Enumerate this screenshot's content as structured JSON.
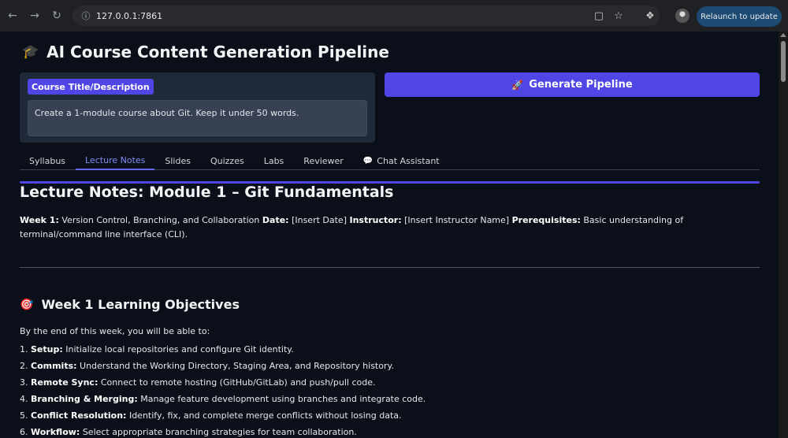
{
  "browser": {
    "url": "127.0.0.1:7861",
    "relaunch_label": "Relaunch to update",
    "icons": {
      "back": "arrow-left-icon",
      "forward": "arrow-right-icon",
      "reload": "reload-icon",
      "site_info": "info-icon",
      "install": "install-app-icon",
      "bookmark": "star-icon",
      "extensions": "puzzle-icon",
      "profile": "avatar"
    }
  },
  "app": {
    "title_emoji": "🎓",
    "title": "AI Course Content Generation Pipeline",
    "input_label": "Course Title/Description",
    "input_value": "Create a 1-module course about Git. Keep it under 50 words.",
    "generate_emoji": "🚀",
    "generate_label": "Generate Pipeline",
    "accent_color": "#4f46e5"
  },
  "tabs": [
    {
      "label": "Syllabus"
    },
    {
      "label": "Lecture Notes",
      "active": true
    },
    {
      "label": "Slides"
    },
    {
      "label": "Quizzes"
    },
    {
      "label": "Labs"
    },
    {
      "label": "Reviewer"
    },
    {
      "label": "Chat Assistant",
      "icon": "💬"
    }
  ],
  "content": {
    "heading": "Lecture Notes: Module 1 – Git Fundamentals",
    "meta": {
      "week_label": "Week 1:",
      "week_value": "Version Control, Branching, and Collaboration",
      "date_label": "Date:",
      "date_value": "[Insert Date]",
      "instructor_label": "Instructor:",
      "instructor_value": "[Insert Instructor Name]",
      "prereq_label": "Prerequisites:",
      "prereq_value": "Basic understanding of terminal/command line interface (CLI)."
    },
    "objectives_emoji": "🎯",
    "objectives_heading": "Week 1 Learning Objectives",
    "objectives_intro": "By the end of this week, you will be able to:",
    "objectives": [
      {
        "num": "1.",
        "label": "Setup:",
        "text": "Initialize local repositories and configure Git identity."
      },
      {
        "num": "2.",
        "label": "Commits:",
        "text": "Understand the Working Directory, Staging Area, and Repository history."
      },
      {
        "num": "3.",
        "label": "Remote Sync:",
        "text": "Connect to remote hosting (GitHub/GitLab) and push/pull code."
      },
      {
        "num": "4.",
        "label": "Branching & Merging:",
        "text": "Manage feature development using branches and integrate code."
      },
      {
        "num": "5.",
        "label": "Conflict Resolution:",
        "text": "Identify, fix, and complete merge conflicts without losing data."
      },
      {
        "num": "6.",
        "label": "Workflow:",
        "text": "Select appropriate branching strategies for team collaboration."
      }
    ]
  }
}
